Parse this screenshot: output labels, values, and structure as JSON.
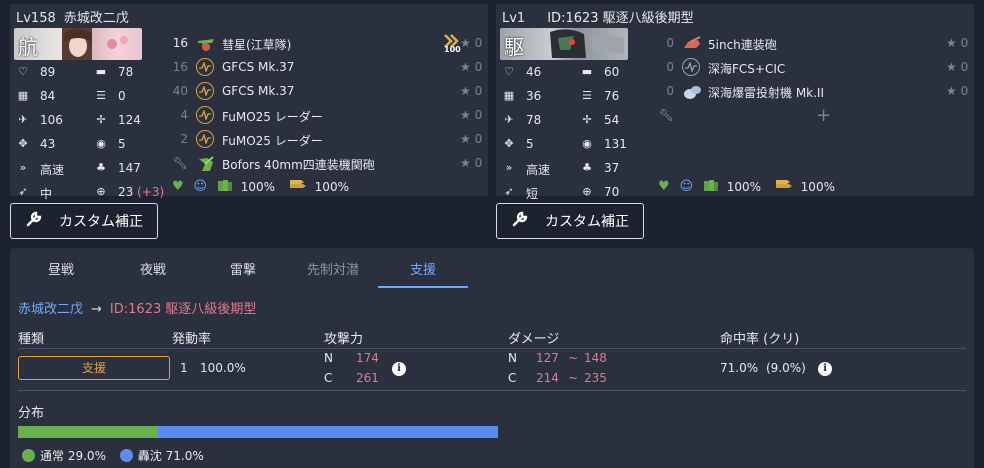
{
  "ship_left": {
    "level": "Lv158",
    "name": "赤城改二戊",
    "portrait_text": "航",
    "stats": {
      "hp": "89",
      "firepower": "78",
      "armor": "84",
      "torpedo": "0",
      "evasion": "106",
      "aa": "124",
      "asw": "43",
      "los": "5",
      "speed": "高速",
      "luck": "147",
      "range": "中",
      "accuracy": "23",
      "accuracy_bonus": "(+3)"
    },
    "slots": [
      {
        "count": "16",
        "name": "彗星(江草隊)",
        "icon": "dive-bomber-icon",
        "rank": "100",
        "star": "0"
      },
      {
        "count": "16",
        "name": "GFCS Mk.37",
        "icon": "fire-control-icon",
        "star": "0"
      },
      {
        "count": "40",
        "name": "GFCS Mk.37",
        "icon": "fire-control-icon",
        "star": "0"
      },
      {
        "count": "4",
        "name": "FuMO25 レーダー",
        "icon": "radar-icon",
        "star": "0"
      },
      {
        "count": "2",
        "name": "FuMO25 レーダー",
        "icon": "radar-icon",
        "star": "0"
      },
      {
        "count": "",
        "name": "Bofors 40mm四連装機関砲",
        "icon": "aa-gun-icon",
        "star": "0"
      }
    ],
    "fuel": "100%",
    "ammo": "100%"
  },
  "ship_right": {
    "level": "Lv1",
    "name": "ID:1623 駆逐八級後期型",
    "portrait_text": "駆",
    "stats": {
      "hp": "46",
      "firepower": "60",
      "armor": "36",
      "torpedo": "76",
      "evasion": "78",
      "aa": "54",
      "asw": "5",
      "los": "131",
      "speed": "高速",
      "luck": "37",
      "range": "短",
      "accuracy": "70"
    },
    "slots": [
      {
        "count": "0",
        "name": "5inch連装砲",
        "icon": "main-gun-icon",
        "star": "0"
      },
      {
        "count": "0",
        "name": "深海FCS+CIC",
        "icon": "fire-control-icon",
        "star": "0"
      },
      {
        "count": "0",
        "name": "深海爆雷投射機 Mk.II",
        "icon": "depth-charge-icon",
        "star": "0"
      }
    ],
    "fuel": "100%",
    "ammo": "100%"
  },
  "buttons": {
    "custom_left": "カスタム補正",
    "custom_right": "カスタム補正"
  },
  "tabs": [
    "昼戦",
    "夜戦",
    "雷撃",
    "先制対潜",
    "支援"
  ],
  "active_tab": "支援",
  "route": {
    "attacker": "赤城改二戊",
    "arrow": "→",
    "defender": "ID:1623 駆逐八級後期型"
  },
  "columns": {
    "type": "種類",
    "rate": "発動率",
    "attack": "攻撃力",
    "damage": "ダメージ",
    "hit": "命中率 (クリ)"
  },
  "row": {
    "type": "支援",
    "rate_count": "1",
    "rate": "100.0%",
    "attack_n_label": "N",
    "attack_n": "174",
    "attack_c_label": "C",
    "attack_c": "261",
    "damage_n_label": "N",
    "damage_n_min": "127",
    "damage_n_max": "148",
    "damage_c_label": "C",
    "damage_c_min": "214",
    "damage_c_max": "235",
    "range_sep": "~",
    "hit": "71.0%",
    "crit": "(9.0%)"
  },
  "distribution": {
    "label": "分布",
    "normal_label": "通常",
    "normal": "29.0%",
    "normal_value": 29.0,
    "sink_label": "轟沈",
    "sink": "71.0%",
    "sink_value": 71.0,
    "colors": {
      "normal": "#6ab04c",
      "sink": "#5b8def"
    }
  }
}
